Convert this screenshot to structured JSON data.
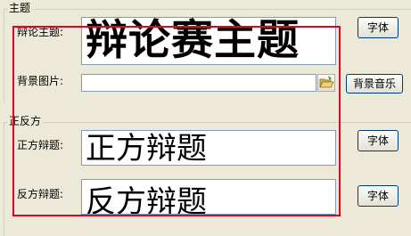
{
  "group_topic": {
    "title": "主题",
    "debate_topic_label": "辩论主题:",
    "debate_topic_value": "辩论赛主题",
    "font_button": "字体",
    "background_image_label": "背景图片:",
    "background_image_value": "",
    "background_music_button": "背景音乐",
    "browse_icon": "folder-open-icon"
  },
  "group_sides": {
    "title": "正反方",
    "pro_label": "正方辩题:",
    "pro_value": "正方辩题",
    "pro_font_button": "字体",
    "con_label": "反方辩题:",
    "con_value": "反方辩题",
    "con_font_button": "字体"
  },
  "highlight_color": "#e8001c"
}
